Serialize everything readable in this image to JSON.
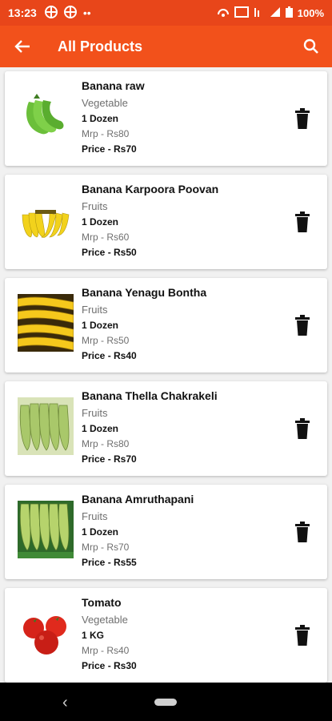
{
  "status": {
    "time": "13:23",
    "battery": "100%"
  },
  "appbar": {
    "title": "All Products"
  },
  "products": [
    {
      "name": "Banana raw",
      "category": "Vegetable",
      "qty": "1 Dozen",
      "mrp": "Mrp - Rs80",
      "price": "Price - Rs70"
    },
    {
      "name": "Banana Karpoora Poovan",
      "category": "Fruits",
      "qty": "1 Dozen",
      "mrp": "Mrp - Rs60",
      "price": "Price - Rs50"
    },
    {
      "name": "Banana Yenagu Bontha",
      "category": "Fruits",
      "qty": "1 Dozen",
      "mrp": "Mrp - Rs50",
      "price": "Price - Rs40"
    },
    {
      "name": "Banana Thella Chakrakeli",
      "category": "Fruits",
      "qty": "1 Dozen",
      "mrp": "Mrp - Rs80",
      "price": "Price - Rs70"
    },
    {
      "name": "Banana Amruthapani",
      "category": "Fruits",
      "qty": "1 Dozen",
      "mrp": "Mrp - Rs70",
      "price": "Price - Rs55"
    },
    {
      "name": "Tomato",
      "category": "Vegetable",
      "qty": "1 KG",
      "mrp": "Mrp - Rs40",
      "price": "Price - Rs30"
    }
  ],
  "colors": {
    "accent": "#f2511b",
    "statusbar": "#e8461a"
  }
}
